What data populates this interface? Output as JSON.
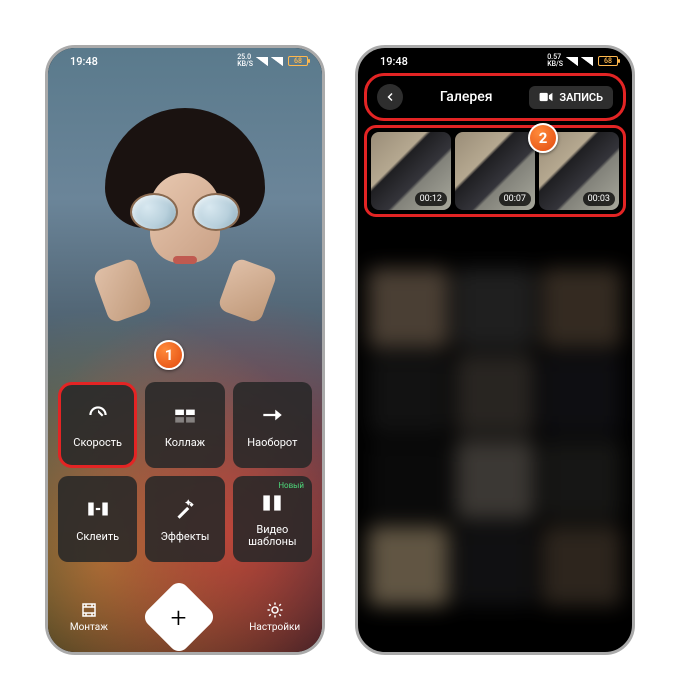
{
  "statusbar": {
    "time": "19:48",
    "net_speed_value": "25.0",
    "net_speed_unit": "KB/S",
    "net_speed_value_2": "0.57",
    "battery": "68"
  },
  "phone1": {
    "tools": {
      "speed": "Скорость",
      "collage": "Коллаж",
      "reverse": "Наоборот",
      "merge": "Склеить",
      "effects": "Эффекты",
      "templates": "Видео шаблоны",
      "new_badge": "Новый"
    },
    "bottom": {
      "montage": "Монтаж",
      "add": "+",
      "settings": "Настройки"
    },
    "step": "1"
  },
  "phone2": {
    "title": "Галерея",
    "record": "ЗАПИСЬ",
    "step": "2",
    "thumbs": [
      {
        "duration": "00:12"
      },
      {
        "duration": "00:07"
      },
      {
        "duration": "00:03"
      }
    ]
  }
}
